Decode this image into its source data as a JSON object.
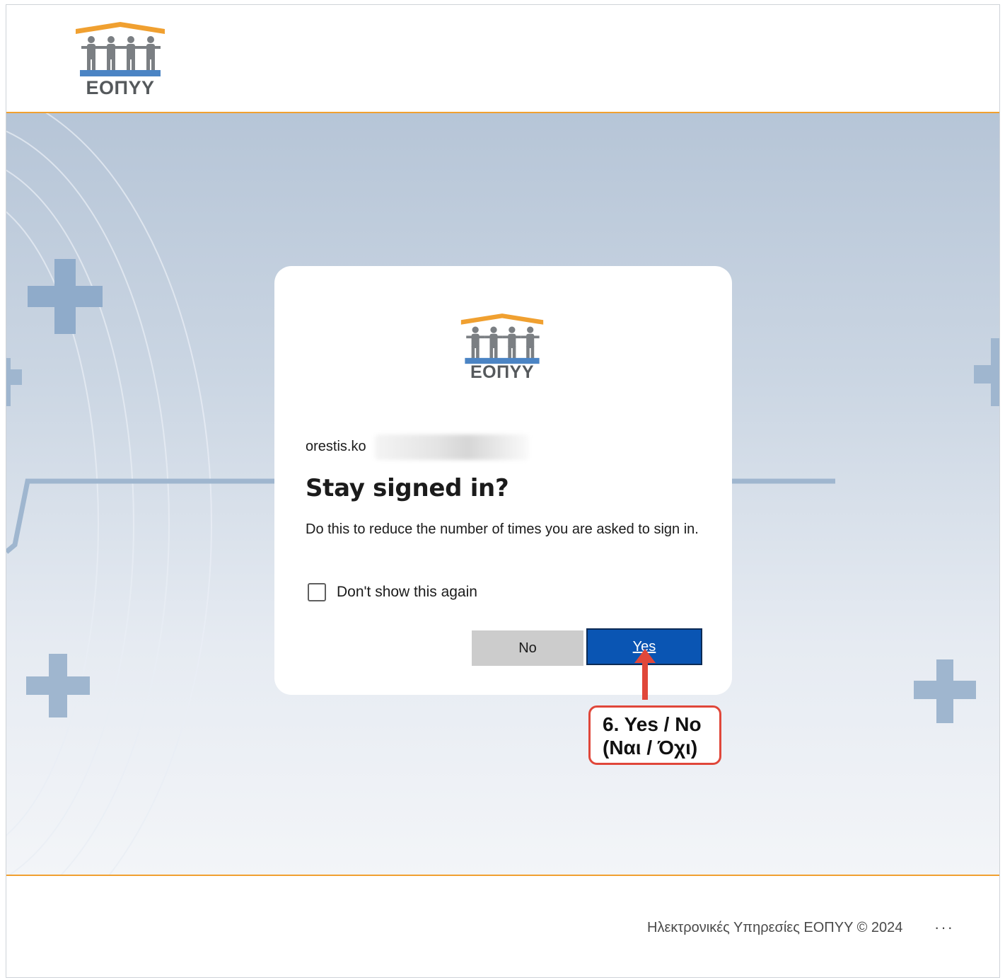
{
  "header": {
    "logo_text": "ΕΟΠΥΥ"
  },
  "card": {
    "logo_text": "ΕΟΠΥΥ",
    "account": "orestis.ko",
    "title": "Stay signed in?",
    "description": "Do this to reduce the number of times you are asked to sign in.",
    "checkbox_label": "Don't show this again",
    "checkbox_checked": false,
    "no_label": "No",
    "yes_label": "Yes"
  },
  "annotation": {
    "line1": "6. Yes / No",
    "line2": "(Ναι / Όχι)"
  },
  "footer": {
    "text": "Ηλεκτρονικές Υπηρεσίες ΕΟΠΥΥ  © 2024",
    "more": "···"
  },
  "colors": {
    "accent_orange": "#f0a030",
    "primary_blue": "#0a55b3",
    "annotation_red": "#e0473a",
    "background_top": "#b6c5d7"
  }
}
